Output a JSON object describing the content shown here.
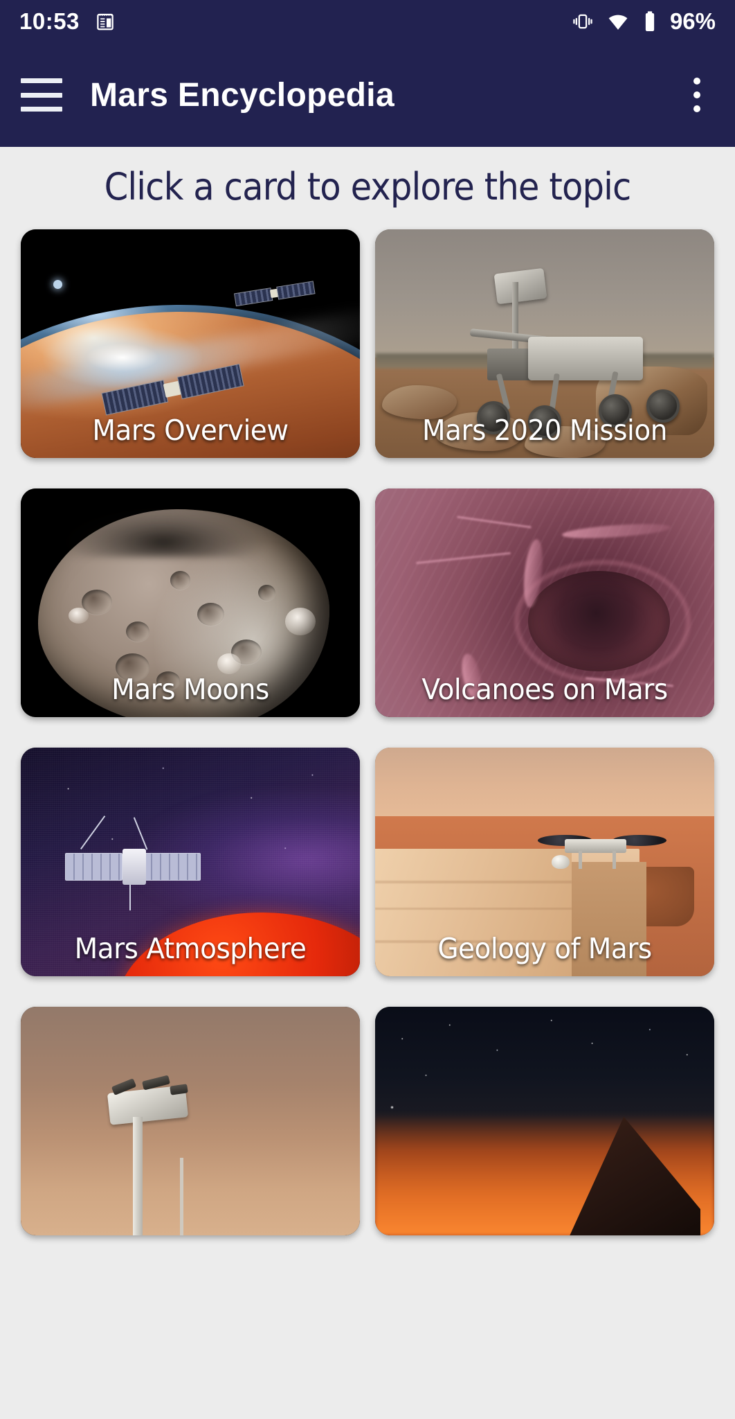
{
  "status_bar": {
    "time": "10:53",
    "notification_icon": "notepad-icon",
    "vibrate_icon": "vibrate-icon",
    "wifi_icon": "wifi-icon",
    "battery_icon": "battery-icon",
    "battery_percent": "96%"
  },
  "app_bar": {
    "menu_icon": "hamburger-menu-icon",
    "title": "Mars Encyclopedia",
    "overflow_icon": "more-vert-icon",
    "background_color": "#222250"
  },
  "page": {
    "heading": "Click a card to explore the topic",
    "heading_color": "#23234f",
    "background_color": "#ececec"
  },
  "cards": [
    {
      "title": "Mars Overview",
      "art": "mars-limb-with-orbiters"
    },
    {
      "title": "Mars 2020 Mission",
      "art": "perseverance-rover-on-surface"
    },
    {
      "title": "Mars Moons",
      "art": "phobos-moon-on-black"
    },
    {
      "title": "Volcanoes on Mars",
      "art": "olympus-mons-caldera"
    },
    {
      "title": "Mars Atmosphere",
      "art": "maven-spacecraft-over-mars"
    },
    {
      "title": "Geology of Mars",
      "art": "insight-lander-soil-cutaway"
    },
    {
      "title": "",
      "art": "weather-mast-instrument"
    },
    {
      "title": "",
      "art": "night-sky-dust-over-peak"
    }
  ]
}
